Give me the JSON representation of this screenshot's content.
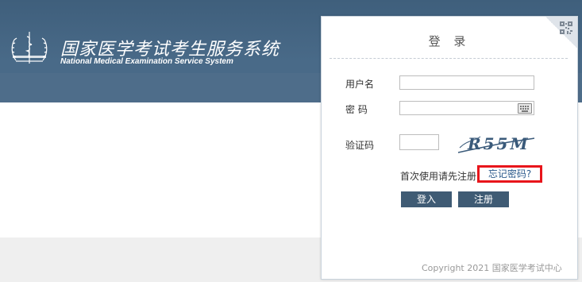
{
  "header": {
    "title": "国家医学考试考生服务系统",
    "subtitle": "National Medical Examination Service System",
    "logo_icon": "medical-emblem-icon"
  },
  "login": {
    "title": "登 录",
    "username_label": "用户名",
    "username_value": "",
    "password_label": "密 码",
    "password_value": "",
    "captcha_label": "验证码",
    "captcha_value": "",
    "captcha_image_text": "R55M",
    "first_use_hint": "首次使用请先注册",
    "forgot_password": "忘记密码?",
    "login_button": "登入",
    "register_button": "注册",
    "qr_icon": "qr-code-icon",
    "keyboard_icon": "virtual-keyboard-icon"
  },
  "footer": {
    "copyright": "Copyright 2021 国家医学考试中心"
  },
  "colors": {
    "banner": "#496a88",
    "button": "#3f5b74",
    "highlight_box": "#e8151b",
    "link": "#2c5a8c"
  }
}
